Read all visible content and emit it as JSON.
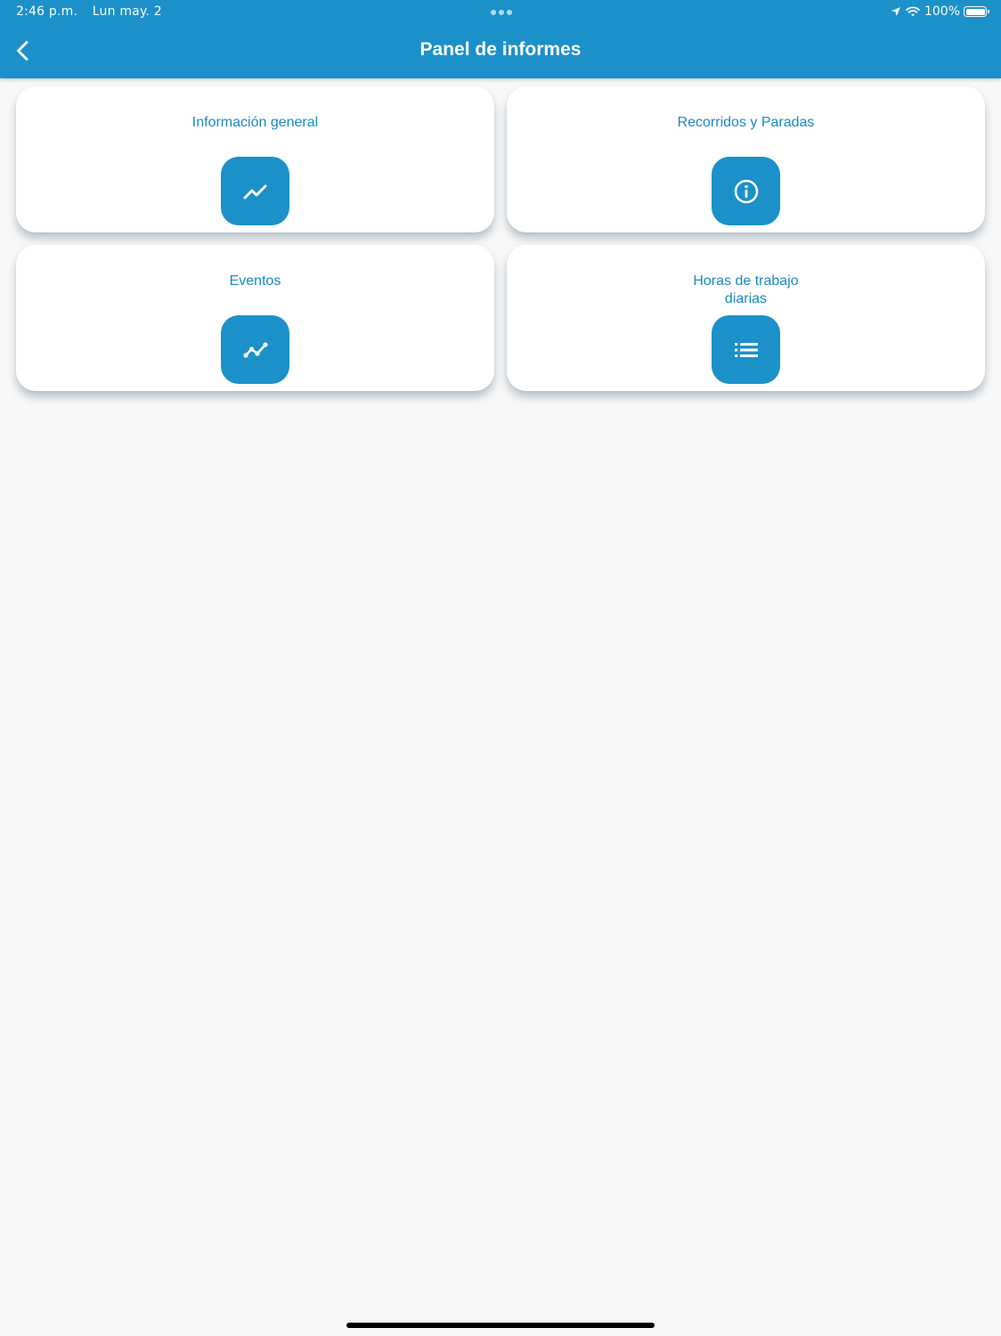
{
  "status_bar": {
    "time": "2:46 p.m.",
    "date": "Lun may. 2",
    "battery": "100%",
    "icons": [
      "location-arrow-icon",
      "wifi-icon",
      "battery-icon"
    ]
  },
  "header": {
    "title": "Panel de informes",
    "back_icon": "chevron-left-icon"
  },
  "cards": [
    {
      "title_lines": [
        "Información general"
      ],
      "icon": "trending-up-icon"
    },
    {
      "title_lines": [
        "Recorridos y Paradas"
      ],
      "icon": "info-circle-icon"
    },
    {
      "title_lines": [
        "Eventos"
      ],
      "icon": "line-chart-icon"
    },
    {
      "title_lines": [
        "Horas de trabajo",
        "diarias"
      ],
      "icon": "list-icon"
    }
  ],
  "colors": {
    "primary": "#1c90c9",
    "card_text": "#1a8ac3",
    "background": "#f8f8f8",
    "card_background": "#ffffff"
  }
}
